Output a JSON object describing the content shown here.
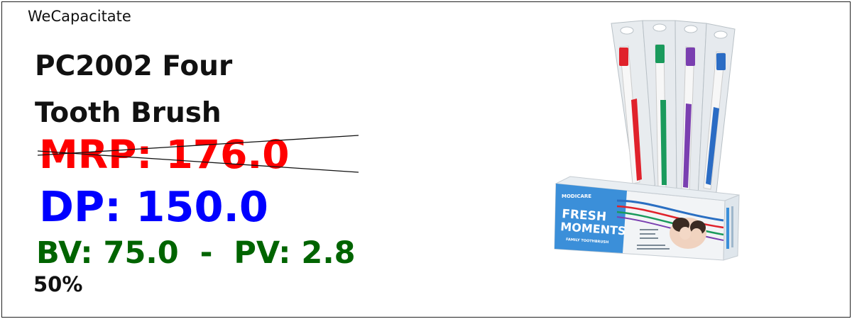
{
  "brand": "WeCapacitate",
  "product": {
    "name_line1": "PC2002 Four",
    "name_line2": "Tooth Brush"
  },
  "pricing": {
    "mrp": "MRP: 176.0",
    "dp": "DP: 150.0",
    "bv_pv": "BV: 75.0  -  PV: 2.8",
    "discount": "50%"
  },
  "image": {
    "box_maker": "MODICARE",
    "box_line1": "FRESH",
    "box_line2": "MOMENTS",
    "box_subtitle": "FAMILY TOOTHBRUSH",
    "icon": "toothbrush-pack-image",
    "brush_colors": [
      "#e0222b",
      "#1a9a5c",
      "#7a3fb0",
      "#2b6cc4"
    ]
  },
  "colors": {
    "mrp": "#ff0000",
    "dp": "#0000ff",
    "bv_pv": "#006400",
    "text": "#111111"
  }
}
